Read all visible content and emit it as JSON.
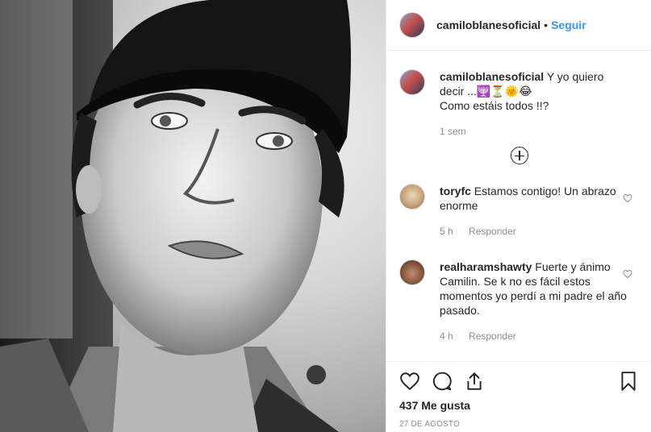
{
  "post": {
    "username": "camiloblanesoficial",
    "follow_label": "Seguir",
    "separator": "•"
  },
  "caption": {
    "username": "camiloblanesoficial",
    "line1": "Y yo quiero decir ...🕎⏳🌞😂",
    "line2": "Como estáis todos !!?",
    "time": "1 sem"
  },
  "comments": [
    {
      "username": "toryfc",
      "text": "Estamos contigo! Un abrazo enorme",
      "time": "5 h",
      "reply_label": "Responder"
    },
    {
      "username": "realharamshawty",
      "text": "Fuerte y ánimo Camilin. Se k no es fácil estos momentos yo perdí a mi padre el año pasado.",
      "time": "4 h",
      "reply_label": "Responder"
    }
  ],
  "footer": {
    "likes": "437 Me gusta",
    "date": "27 DE AGOSTO"
  },
  "icons": {
    "like": "heart-icon",
    "comment": "comment-icon",
    "share": "share-icon",
    "save": "bookmark-icon",
    "load_more": "plus-circle-icon"
  },
  "colors": {
    "link": "#3897f0",
    "text": "#262626",
    "secondary": "#8e8e8e",
    "divider": "#efefef"
  }
}
